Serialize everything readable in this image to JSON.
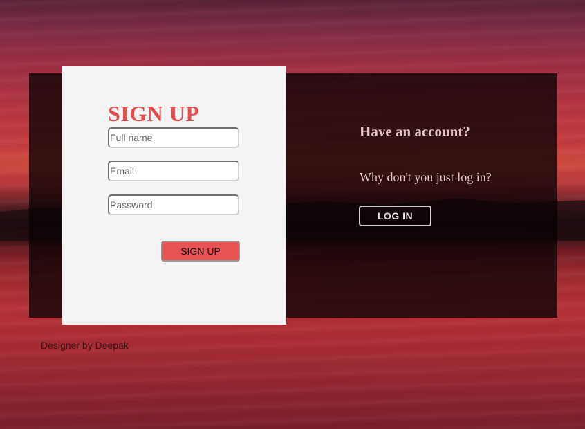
{
  "signup": {
    "title": "SIGN UP",
    "fields": {
      "full_name_placeholder": "Full name",
      "email_placeholder": "Email",
      "password_placeholder": "Password"
    },
    "submit_label": "SIGN UP"
  },
  "login_prompt": {
    "heading": "Have an account?",
    "text": "Why don't you just log in?",
    "button_label": "LOG IN"
  },
  "footer": {
    "credit": "Designer by Deepak"
  },
  "colors": {
    "accent": "#e85454",
    "card_background": "#f4f4f4",
    "overlay": "rgba(10, 2, 4, 0.78)",
    "prompt_text": "#e7c2c4"
  }
}
